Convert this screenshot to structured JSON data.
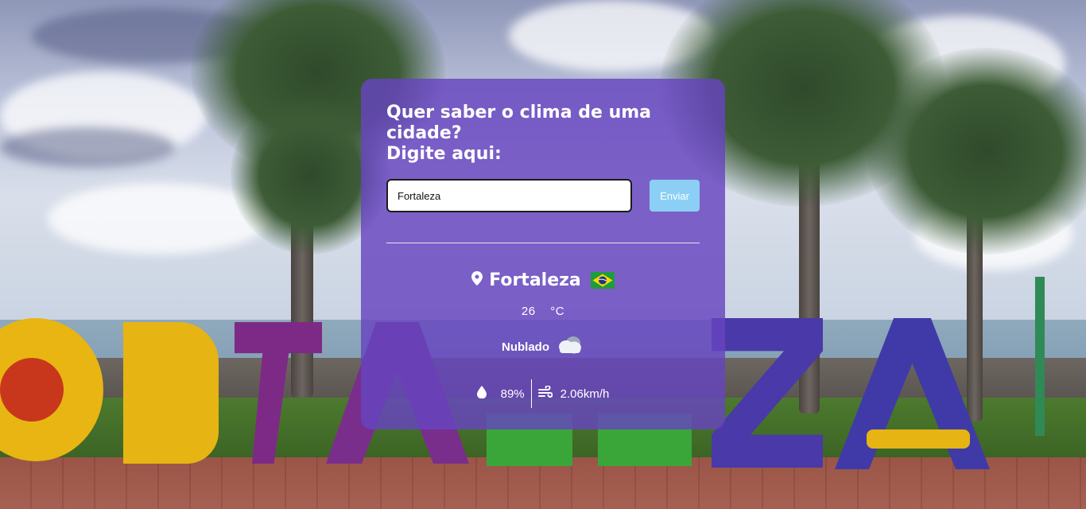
{
  "form": {
    "title_line1": "Quer saber o clima de uma cidade?",
    "title_line2": "Digite aqui:",
    "city_input_value": "Fortaleza",
    "submit_label": "Enviar"
  },
  "weather": {
    "city": "Fortaleza",
    "country_flag": "brazil-flag",
    "temperature": "26",
    "temperature_unit": "°C",
    "description": "Nublado",
    "description_icon": "cloudy-icon",
    "humidity": "89%",
    "humidity_icon": "water-drop-icon",
    "wind": "2.06km/h",
    "wind_icon": "wind-icon",
    "location_icon": "map-pin-icon"
  },
  "colors": {
    "card_background": "#6744c0",
    "button_background": "#8ccff5",
    "text": "#ffffff"
  }
}
